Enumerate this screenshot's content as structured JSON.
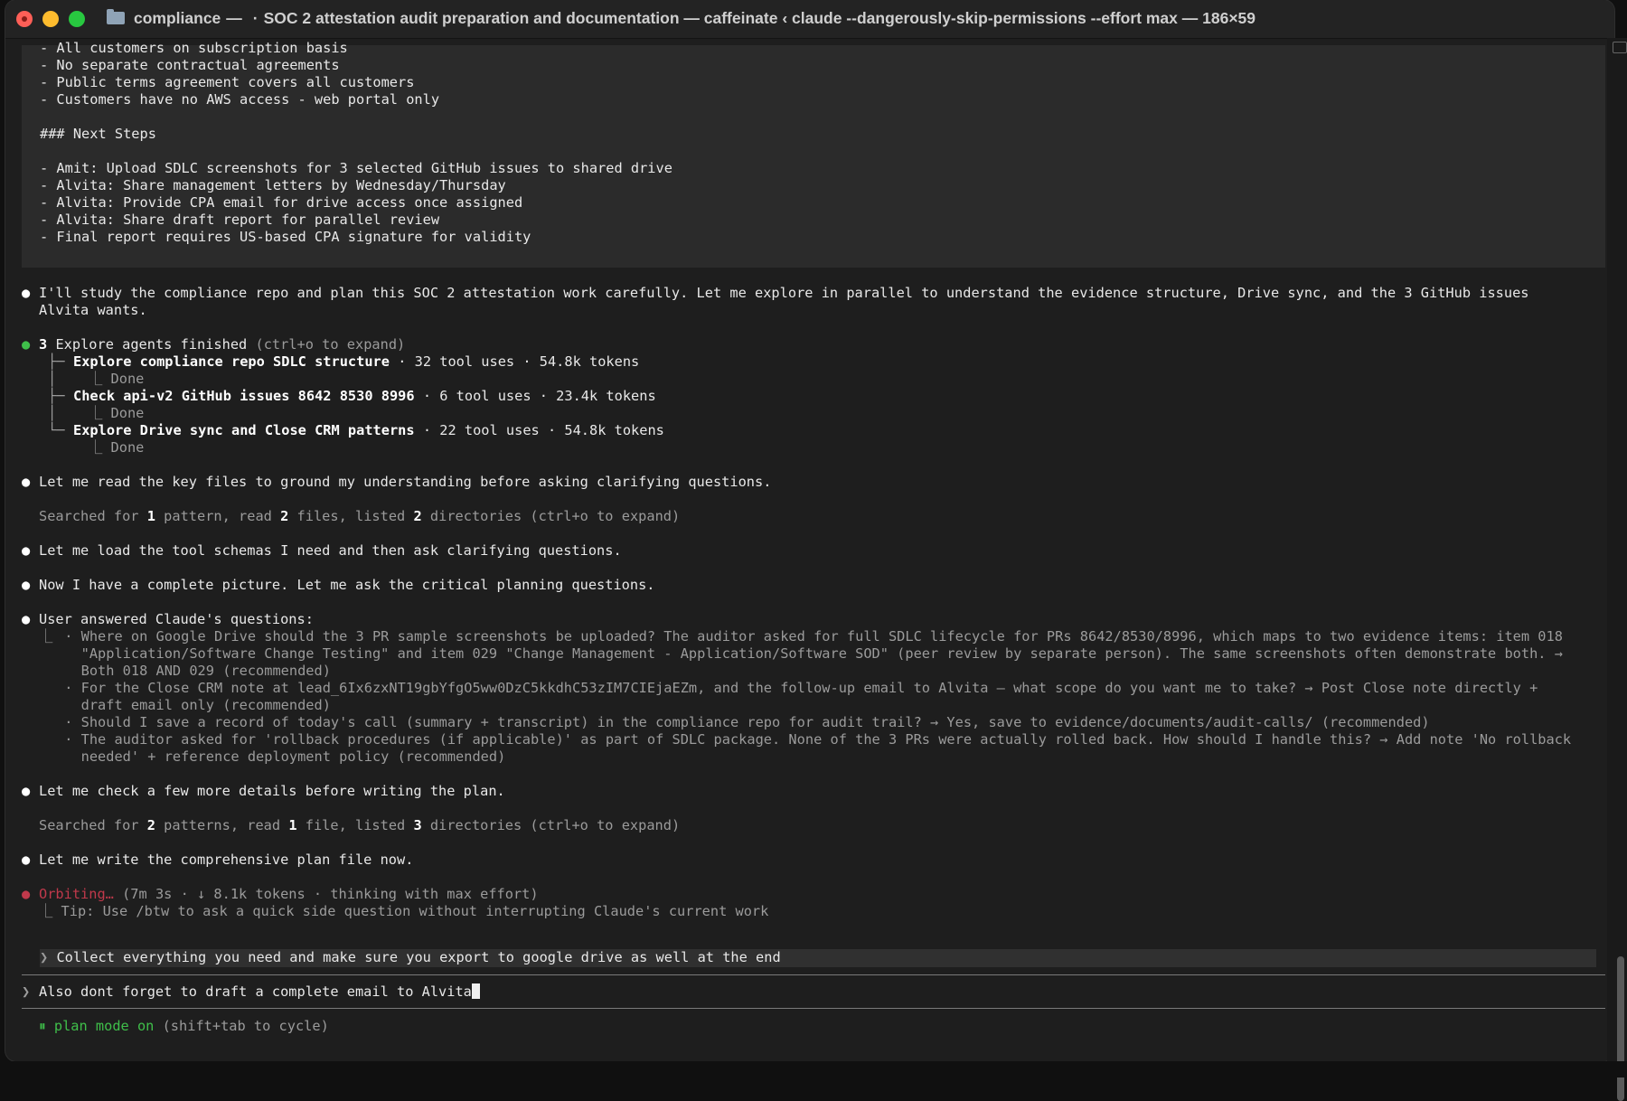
{
  "window": {
    "folder": "compliance",
    "dash": "—",
    "dot": "·",
    "title": "SOC 2 attestation audit preparation and documentation — caffeinate ‹ claude --dangerously-skip-permissions --effort max — 186×59"
  },
  "quoted_block": {
    "lines": [
      "- All customers on subscription basis",
      "- No separate contractual agreements",
      "- Public terms agreement covers all customers",
      "- Customers have no AWS access - web portal only",
      "",
      "### Next Steps",
      "",
      "- Amit: Upload SDLC screenshots for 3 selected GitHub issues to shared drive",
      "- Alvita: Share management letters by Wednesday/Thursday",
      "- Alvita: Provide CPA email for drive access once assigned",
      "- Alvita: Share draft report for parallel review",
      "- Final report requires US-based CPA signature for validity"
    ]
  },
  "transcript": {
    "intro_line1": "I'll study the compliance repo and plan this SOC 2 attestation work carefully. Let me explore in parallel to understand the evidence structure, Drive sync, and the 3 GitHub issues",
    "intro_line2": "Alvita wants.",
    "agents_count": "3",
    "agents_title": "Explore agents finished",
    "agents_hint": "(ctrl+o to expand)",
    "agents": [
      {
        "name": "Explore compliance repo SDLC structure",
        "stats": "· 32 tool uses · 54.8k tokens",
        "status": "Done"
      },
      {
        "name": "Check api-v2 GitHub issues 8642 8530 8996",
        "stats": "· 6 tool uses · 23.4k tokens",
        "status": "Done"
      },
      {
        "name": "Explore Drive sync and Close CRM patterns",
        "stats": "· 22 tool uses · 54.8k tokens",
        "status": "Done"
      }
    ],
    "read_key_files": "Let me read the key files to ground my understanding before asking clarifying questions.",
    "search1": {
      "prefix": "Searched for ",
      "n1": "1",
      "mid1": " pattern, read ",
      "n2": "2",
      "mid2": " files, listed ",
      "n3": "2",
      "suffix": " directories (ctrl+o to expand)"
    },
    "load_schemas": "Let me load the tool schemas I need and then ask clarifying questions.",
    "complete_picture": "Now I have a complete picture. Let me ask the critical planning questions.",
    "user_answered": "User answered Claude's questions:",
    "qa_lines": [
      " · Where on Google Drive should the 3 PR sample screenshots be uploaded? The auditor asked for full SDLC lifecycle for PRs 8642/8530/8996, which maps to two evidence items: item 018",
      "   \"Application/Software Change Testing\" and item 029 \"Change Management - Application/Software SOD\" (peer review by separate person). The same screenshots often demonstrate both. →",
      "   Both 018 AND 029 (recommended)",
      " · For the Close CRM note at lead_6Ix6zxNT19gbYfgO5ww0DzC5kkdhC53zIM7CIEjaEZm, and the follow-up email to Alvita — what scope do you want me to take? → Post Close note directly +",
      "   draft email only (recommended)",
      " · Should I save a record of today's call (summary + transcript) in the compliance repo for audit trail? → Yes, save to evidence/documents/audit-calls/ (recommended)",
      " · The auditor asked for 'rollback procedures (if applicable)' as part of SDLC package. None of the 3 PRs were actually rolled back. How should I handle this? → Add note 'No rollback",
      "   needed' + reference deployment policy (recommended)"
    ],
    "check_details": "Let me check a few more details before writing the plan.",
    "search2": {
      "prefix": "Searched for ",
      "n1": "2",
      "mid1": " patterns, read ",
      "n2": "1",
      "mid2": " file, listed ",
      "n3": "3",
      "suffix": " directories (ctrl+o to expand)"
    },
    "write_plan": "Let me write the comprehensive plan file now.",
    "status": {
      "word": "Orbiting…",
      "meta": " (7m 3s · ↓ 8.1k tokens · thinking with max effort)"
    },
    "tip": "Tip: Use /btw to ask a quick side question without interrupting Claude's current work",
    "queued_message": "Collect everything you need and make sure you export to google drive as well at the end"
  },
  "input": {
    "prompt": "❯",
    "value": "Also dont forget to draft a complete email to Alvita"
  },
  "footer": {
    "mode": "plan mode on",
    "hint": " (shift+tab to cycle)"
  },
  "glyphs": {
    "bullet": "●",
    "tree_branch": "├─",
    "tree_last": "└─",
    "tree_pipe": "│",
    "corner": "⎿",
    "mode_icon": "⏸",
    "queued_prompt": "❯"
  }
}
